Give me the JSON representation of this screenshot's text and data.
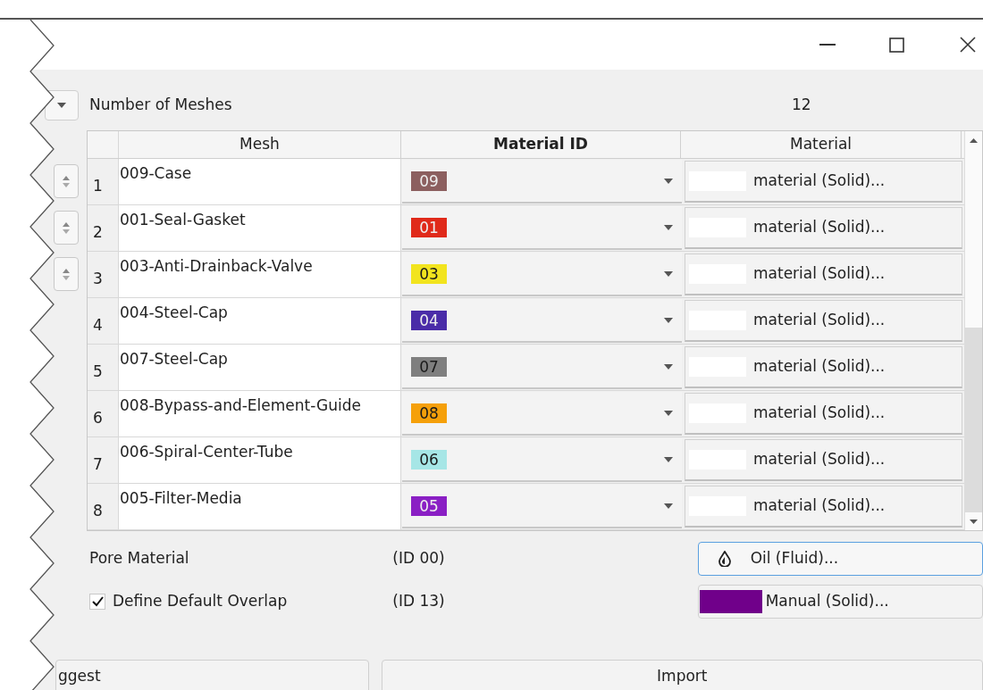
{
  "mesh_count": {
    "label": "Number of Meshes",
    "value": "12"
  },
  "table": {
    "columns": [
      {
        "label": "Mesh",
        "emphasized": false
      },
      {
        "label": "Material ID",
        "emphasized": true
      },
      {
        "label": "Material",
        "emphasized": false
      }
    ],
    "rows": [
      {
        "number": "1",
        "mesh": "009-Case",
        "material_id": "09",
        "color": "#8c5f5f",
        "material": "material (Solid)...",
        "spinner": true
      },
      {
        "number": "2",
        "mesh": "001-Seal-Gasket",
        "material_id": "01",
        "color": "#e02a1a",
        "material": "material (Solid)...",
        "spinner": true
      },
      {
        "number": "3",
        "mesh": "003-Anti-Drainback-Valve",
        "material_id": "03",
        "color": "#f2e41e",
        "material": "material (Solid)...",
        "spinner": true
      },
      {
        "number": "4",
        "mesh": "004-Steel-Cap",
        "material_id": "04",
        "color": "#4a2ca8",
        "material": "material (Solid)...",
        "spinner": false
      },
      {
        "number": "5",
        "mesh": "007-Steel-Cap",
        "material_id": "07",
        "color": "#7f7f7f",
        "material": "material (Solid)...",
        "spinner": false
      },
      {
        "number": "6",
        "mesh": "008-Bypass-and-Element-Guide",
        "material_id": "08",
        "color": "#f5a00a",
        "material": "material (Solid)...",
        "spinner": false
      },
      {
        "number": "7",
        "mesh": "006-Spiral-Center-Tube",
        "material_id": "06",
        "color": "#a6e6e6",
        "material": "material (Solid)...",
        "spinner": false
      },
      {
        "number": "8",
        "mesh": "005-Filter-Media",
        "material_id": "05",
        "color": "#8a1fc4",
        "material": "material (Solid)...",
        "spinner": false
      }
    ]
  },
  "pore_material": {
    "label": "Pore Material",
    "id": "(ID 00)",
    "material": "Oil (Fluid)...",
    "focused": true
  },
  "default_overlap": {
    "label": "Define Default Overlap",
    "checked": true,
    "id": "(ID 13)",
    "material": "Manual (Solid)...",
    "color": "#70008a"
  },
  "buttons": [
    "ggest",
    "Import"
  ]
}
